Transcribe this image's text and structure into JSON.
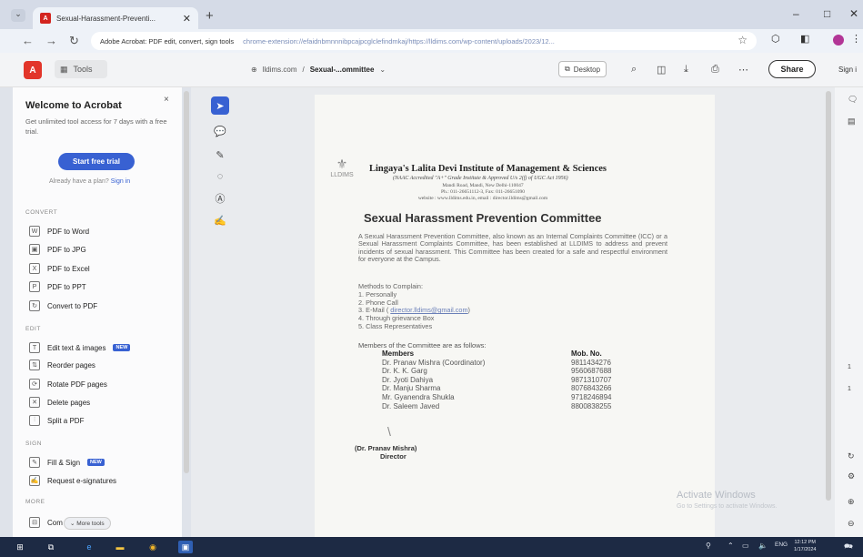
{
  "browser": {
    "tab_title": "Sexual-Harassment-Preventi...",
    "tab_favicon": "A",
    "tab_close": "✕",
    "new_tab": "+",
    "tab_dropdown": "⌄",
    "minimize": "–",
    "maximize": "□",
    "close": "✕",
    "site_label": "Adobe Acrobat: PDF edit, convert, sign tools",
    "url": "chrome-extension://efaidnbmnnnibpcajpcglclefindmkaj/https://lldims.com/wp-content/uploads/2023/12...",
    "back": "←",
    "forward": "→",
    "reload": "↻"
  },
  "acrobat_toolbar": {
    "logo": "A",
    "tools_label": "Tools",
    "breadcrumb_site": "lldims.com",
    "breadcrumb_sep": "/",
    "breadcrumb_file": "Sexual-...ommittee",
    "desktop_label": "Desktop",
    "share_label": "Share",
    "signin_label": "Sign i"
  },
  "left_panel": {
    "close": "×",
    "title": "Welcome to Acrobat",
    "subtitle": "Get unlimited tool access for 7 days with a free trial.",
    "trial_button": "Start free trial",
    "have_plan": "Already have a plan?",
    "sign_in": "Sign in",
    "sections": {
      "convert": "CONVERT",
      "edit": "EDIT",
      "sign": "SIGN",
      "more": "MORE"
    },
    "convert_items": [
      "PDF to Word",
      "PDF to JPG",
      "PDF to Excel",
      "PDF to PPT",
      "Convert to PDF"
    ],
    "edit_items": [
      "Edit text & images",
      "Reorder pages",
      "Rotate PDF pages",
      "Delete pages",
      "Split a PDF"
    ],
    "sign_items": [
      "Fill & Sign",
      "Request e-signatures"
    ],
    "more_item": "Com",
    "more_tools": "More tools",
    "new_badge": "NEW"
  },
  "document": {
    "logo_text": "LLDIMS",
    "institute_name": "Lingaya's Lalita Devi Institute of Management & Sciences",
    "institute_sub": "(NAAC Accredited \"A+\" Grade Institute & Approved U/s 2(f) of UGC Act 1956)",
    "address_lines": [
      "Mandi Road, Mandi, New Delhi-110047",
      "Ph.: 011-26651112-3, Fax: 011-26651090",
      "website : www.lldims.edu.in, email : director.lldims@gmail.com"
    ],
    "title": "Sexual Harassment  Prevention Committee",
    "paragraph": "A Sexual Harassment Prevention Committee, also known as an Internal Complaints Committee (ICC) or a Sexual Harassment Complaints Committee, has been established at LLDIMS to address and prevent incidents of sexual harassment. This Committee has been created for a safe and respectful environment for everyone at the Campus.",
    "methods_heading": "Methods to Complain:",
    "methods": [
      "1. Personally",
      "2. Phone Call",
      "3. E-Mail ( ",
      "4. Through grievance Box",
      "5. Class Representatives"
    ],
    "email_link": "director.lldims@gmail.com",
    "email_close": ")",
    "members_intro": "Members of the Committee are as follows:",
    "members_header": [
      "Members",
      "Mob. No."
    ],
    "members": [
      {
        "name": "Dr. Pranav Mishra (Coordinator)",
        "mobile": "9811434276"
      },
      {
        "name": "Dr. K. K. Garg",
        "mobile": "9560687688"
      },
      {
        "name": "Dr. Jyoti Dahiya",
        "mobile": "9871310707"
      },
      {
        "name": "Dr. Manju Sharma",
        "mobile": "8076843266"
      },
      {
        "name": "Mr. Gyanendra Shukla",
        "mobile": "9718246894"
      },
      {
        "name": "Dr. Saleem Javed",
        "mobile": "8800838255"
      }
    ],
    "signer_name": "(Dr. Pranav Mishra)",
    "signer_role": "Director"
  },
  "overlay": {
    "watermark_title": "Activate Windows",
    "watermark_sub": "Go to Settings to activate Windows."
  },
  "page_nav": {
    "page_current": "1",
    "page_total": "1"
  },
  "taskbar": {
    "lang": "ENG",
    "time": "12:12 PM",
    "date": "1/17/2024"
  }
}
